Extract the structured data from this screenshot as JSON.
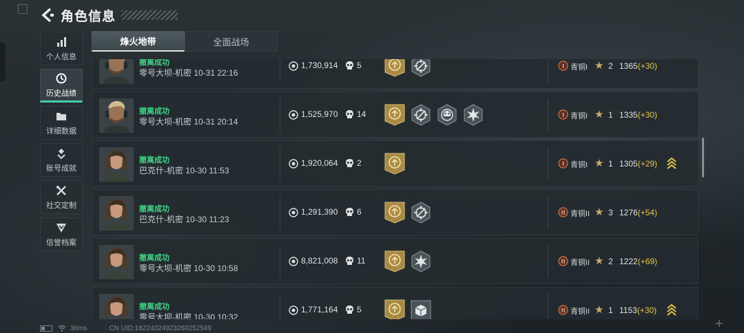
{
  "header": {
    "title": "角色信息"
  },
  "sidebar": {
    "items": [
      {
        "label": "个人信息",
        "icon": "bar-chart-icon",
        "active": false
      },
      {
        "label": "历史战绩",
        "icon": "clock-icon",
        "active": true
      },
      {
        "label": "详细数据",
        "icon": "folder-icon",
        "active": false
      },
      {
        "label": "账号成就",
        "icon": "achievement-icon",
        "active": false
      },
      {
        "label": "社交定制",
        "icon": "tools-icon",
        "active": false
      },
      {
        "label": "信誉档案",
        "icon": "shield-icon",
        "active": false
      }
    ]
  },
  "tabs": [
    {
      "label": "烽火地带",
      "active": true
    },
    {
      "label": "全面战场",
      "active": false
    }
  ],
  "records": [
    {
      "status": "撤离成功",
      "map": "零号大坝-机密 10-31 22:16",
      "value": "1,730,914",
      "kills": "5",
      "badges": [
        "extract-badge",
        "crosshair-badge"
      ],
      "rank": "青铜I",
      "rank_numeral": "I",
      "stars": "2",
      "score": "1365",
      "delta": "(+30)",
      "chevron": false,
      "avatar": "male"
    },
    {
      "status": "撤离成功",
      "map": "零号大坝-机密 10-31 20:14",
      "value": "1,525,970",
      "kills": "14",
      "badges": [
        "extract-badge",
        "crosshair-badge",
        "skull-badge",
        "burst-badge"
      ],
      "rank": "青铜I",
      "rank_numeral": "I",
      "stars": "1",
      "score": "1335",
      "delta": "(+30)",
      "chevron": false,
      "avatar": "male"
    },
    {
      "status": "撤离成功",
      "map": "巴克什-机密 10-30 11:53",
      "value": "1,920,064",
      "kills": "2",
      "badges": [
        "extract-badge"
      ],
      "rank": "青铜I",
      "rank_numeral": "I",
      "stars": "1",
      "score": "1305",
      "delta": "(+29)",
      "chevron": true,
      "avatar": "female"
    },
    {
      "status": "撤离成功",
      "map": "巴克什-机密 10-30 11:23",
      "value": "1,291,390",
      "kills": "6",
      "badges": [
        "extract-badge",
        "crosshair-badge"
      ],
      "rank": "青铜II",
      "rank_numeral": "II",
      "stars": "3",
      "score": "1276",
      "delta": "(+54)",
      "chevron": false,
      "avatar": "female"
    },
    {
      "status": "撤离成功",
      "map": "零号大坝-机密 10-30 10:58",
      "value": "8,821,008",
      "kills": "11",
      "badges": [
        "extract-badge",
        "burst-badge"
      ],
      "rank": "青铜II",
      "rank_numeral": "II",
      "stars": "2",
      "score": "1222",
      "delta": "(+69)",
      "chevron": false,
      "avatar": "female"
    },
    {
      "status": "撤离成功",
      "map": "零号大坝-机密 10-30 10:32",
      "value": "1,771,164",
      "kills": "5",
      "badges": [
        "extract-badge",
        "cargo-badge"
      ],
      "rank": "青铜II",
      "rank_numeral": "II",
      "stars": "1",
      "score": "1153",
      "delta": "(+30)",
      "chevron": true,
      "avatar": "female"
    }
  ],
  "footer": {
    "ping": "36ms",
    "uid": "CN UID:18224024923260252549"
  },
  "colors": {
    "accent": "#3fd0a6",
    "success": "#3fd486",
    "delta": "#e6c54a",
    "badge_gold": "#b5964f",
    "rank_bronze": "#c06a45"
  }
}
